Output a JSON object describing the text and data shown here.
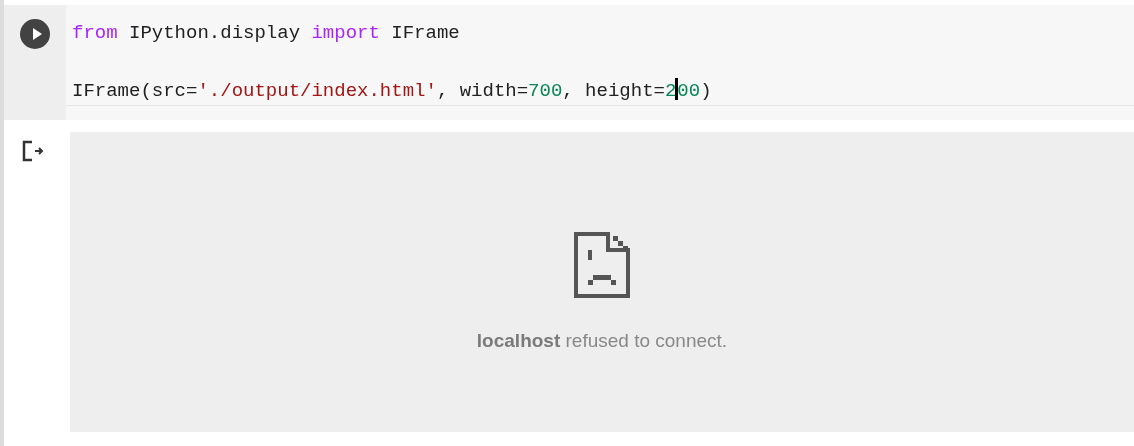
{
  "code_cell": {
    "lines": [
      [
        {
          "kind": "keyword",
          "text": "from"
        },
        {
          "kind": "plain",
          "text": " IPython.display "
        },
        {
          "kind": "keyword",
          "text": "import"
        },
        {
          "kind": "plain",
          "text": " IFrame"
        }
      ],
      [
        {
          "kind": "plain",
          "text": "IFrame(src="
        },
        {
          "kind": "string",
          "text": "'./output/index.html'"
        },
        {
          "kind": "plain",
          "text": ", width="
        },
        {
          "kind": "number",
          "text": "700"
        },
        {
          "kind": "plain",
          "text": ", height="
        },
        {
          "kind": "number",
          "text": "2"
        },
        {
          "kind": "cursor"
        },
        {
          "kind": "number",
          "text": "00"
        },
        {
          "kind": "plain",
          "text": ")"
        }
      ]
    ]
  },
  "output": {
    "message": "**localhost** refused to connect."
  }
}
